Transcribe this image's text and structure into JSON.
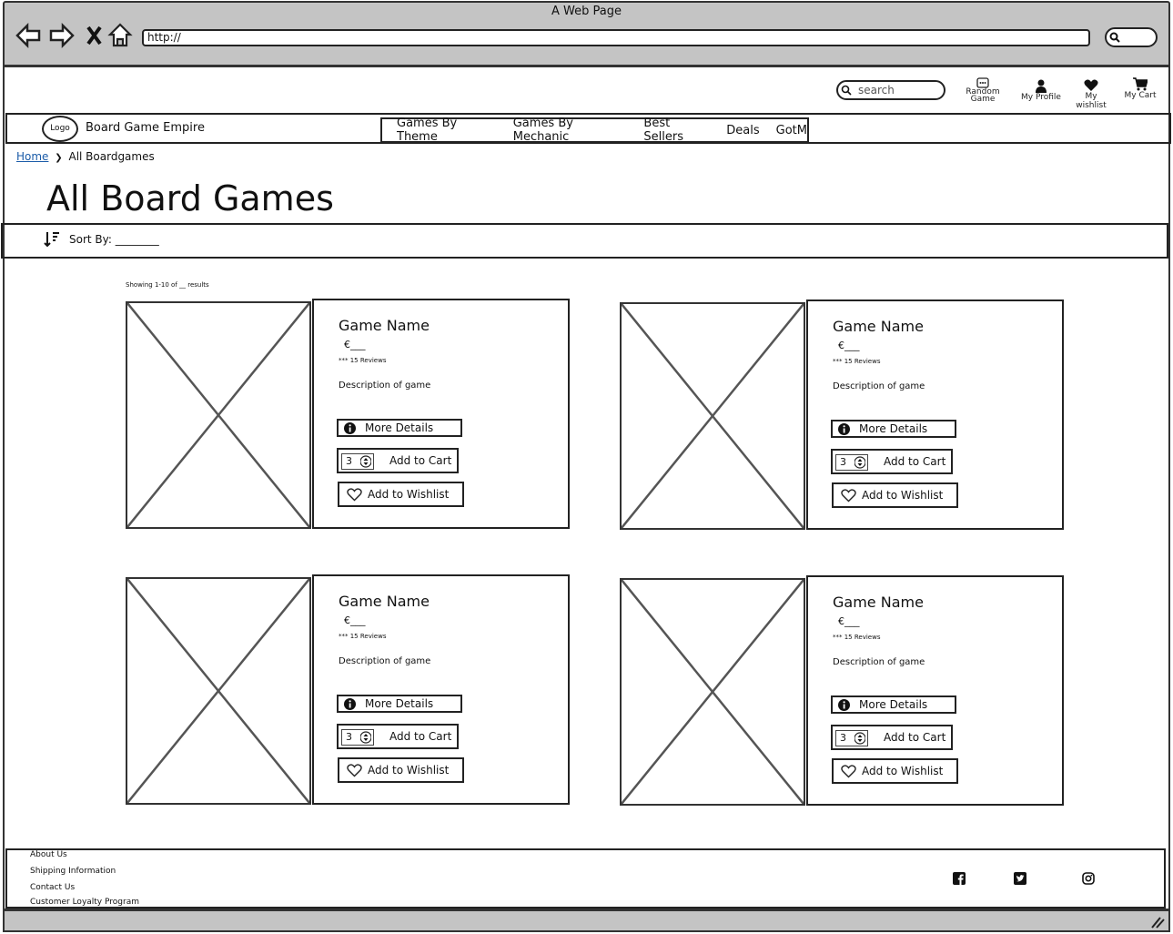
{
  "window": {
    "title": "A Web Page",
    "url": "http://"
  },
  "header": {
    "search_placeholder": "search",
    "icons": [
      {
        "label": "Random Game",
        "icon": "dice-icon"
      },
      {
        "label": "My Profile",
        "icon": "user-icon"
      },
      {
        "label": "My wishlist",
        "icon": "heart-icon"
      },
      {
        "label": "My Cart",
        "icon": "cart-icon"
      }
    ]
  },
  "brand": {
    "logo_label": "Logo",
    "name": "Board Game Empire"
  },
  "nav": {
    "items": [
      "Games By Theme",
      "Games By Mechanic",
      "Best Sellers",
      "Deals",
      "GotM"
    ]
  },
  "breadcrumb": {
    "home": "Home",
    "separator": "❯",
    "current": "All Boardgames"
  },
  "page_title": "All Board Games",
  "sort": {
    "label": "Sort By: ________"
  },
  "results_text": "Showing 1-10 of __ results",
  "products": [
    {
      "name": "Game Name",
      "price": "€___",
      "reviews": "*** 15 Reviews",
      "description": "Description of game",
      "details_label": "More Details",
      "qty": "3",
      "cart_label": "Add to Cart",
      "wishlist_label": "Add to Wishlist"
    },
    {
      "name": "Game Name",
      "price": "€___",
      "reviews": "*** 15 Reviews",
      "description": "Description of game",
      "details_label": "More Details",
      "qty": "3",
      "cart_label": "Add to Cart",
      "wishlist_label": "Add to Wishlist"
    },
    {
      "name": "Game Name",
      "price": "€___",
      "reviews": "*** 15 Reviews",
      "description": "Description of game",
      "details_label": "More Details",
      "qty": "3",
      "cart_label": "Add to Cart",
      "wishlist_label": "Add to Wishlist"
    },
    {
      "name": "Game Name",
      "price": "€___",
      "reviews": "*** 15 Reviews",
      "description": "Description of game",
      "details_label": "More Details",
      "qty": "3",
      "cart_label": "Add to Cart",
      "wishlist_label": "Add to Wishlist"
    }
  ],
  "footer": {
    "links": [
      "About Us",
      "Shipping Information",
      "Contact Us",
      "Customer Loyalty Program"
    ],
    "social": [
      "facebook-icon",
      "twitter-icon",
      "instagram-icon"
    ]
  }
}
